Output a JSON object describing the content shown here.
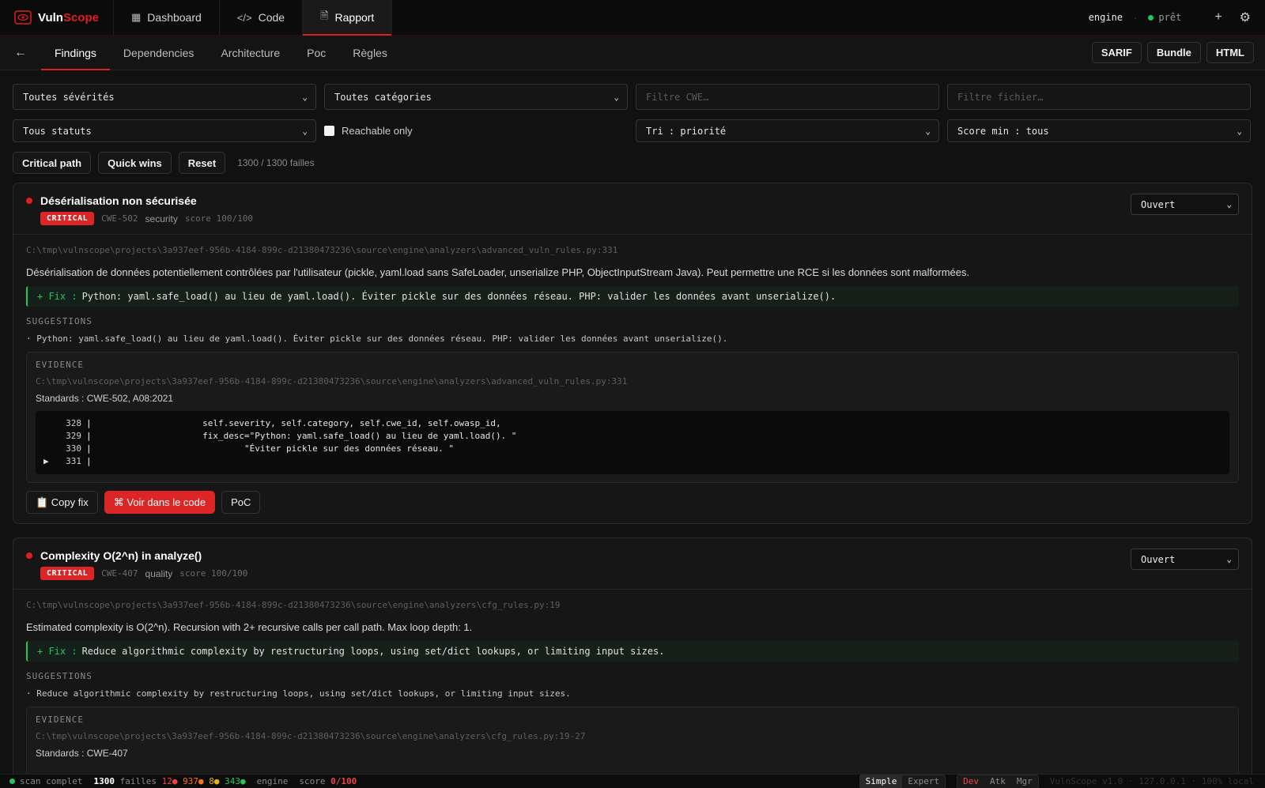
{
  "brand": {
    "name_a": "Vuln",
    "name_b": "Scope"
  },
  "topnav": [
    {
      "label": "Dashboard",
      "icon": "grid-icon"
    },
    {
      "label": "Code",
      "icon": "code-icon"
    },
    {
      "label": "Rapport",
      "icon": "document-icon",
      "active": true
    }
  ],
  "topright": {
    "engine": "engine",
    "sep": "·",
    "status": "prêt",
    "add": "+",
    "settings": "⚙"
  },
  "tabs": [
    "Findings",
    "Dependencies",
    "Architecture",
    "Poc",
    "Règles"
  ],
  "exports": [
    "SARIF",
    "Bundle",
    "HTML"
  ],
  "filters": {
    "severity": "Toutes sévérités",
    "category": "Toutes catégories",
    "cwe_placeholder": "Filtre CWE…",
    "file_placeholder": "Filtre fichier…",
    "status": "Tous statuts",
    "reachable": "Reachable only",
    "sort": "Tri : priorité",
    "score": "Score min : tous"
  },
  "quick": {
    "critical": "Critical path",
    "wins": "Quick wins",
    "reset": "Reset",
    "count": "1300 / 1300 failles"
  },
  "findings": [
    {
      "title": "Désérialisation non sécurisée",
      "severity": "CRITICAL",
      "cwe": "CWE-502",
      "category": "security",
      "score": "score 100/100",
      "status": "Ouvert",
      "path": "C:\\tmp\\vulnscope\\projects\\3a937eef-956b-4184-899c-d21380473236\\source\\engine\\analyzers\\advanced_vuln_rules.py:331",
      "description": "Désérialisation de données potentiellement contrôlées par l'utilisateur (pickle, yaml.load sans SafeLoader, unserialize PHP, ObjectInputStream Java). Peut permettre une RCE si les données sont malformées.",
      "fix_prefix": "+ Fix :",
      "fix": "Python: yaml.safe_load() au lieu de yaml.load(). Éviter pickle sur des données réseau. PHP: valider les données avant unserialize().",
      "suggestions_label": "SUGGESTIONS",
      "suggestion": "· Python: yaml.safe_load() au lieu de yaml.load(). Éviter pickle sur des données réseau. PHP: valider les données avant unserialize().",
      "evidence_label": "EVIDENCE",
      "evidence_path": "C:\\tmp\\vulnscope\\projects\\3a937eef-956b-4184-899c-d21380473236\\source\\engine\\analyzers\\advanced_vuln_rules.py:331",
      "standards": "Standards : CWE-502, A08:2021",
      "code": [
        {
          "marker": "",
          "line": "328",
          "text": "                    self.severity, self.category, self.cwe_id, self.owasp_id,"
        },
        {
          "marker": "",
          "line": "329",
          "text": "                    fix_desc=\"Python: yaml.safe_load() au lieu de yaml.load(). \""
        },
        {
          "marker": "",
          "line": "330",
          "text": "                            \"Éviter pickle sur des données réseau. \""
        },
        {
          "marker": "▶",
          "line": "331",
          "text": ""
        }
      ],
      "actions": {
        "copy": "📋 Copy fix",
        "view": "⌘ Voir dans le code",
        "poc": "PoC"
      }
    },
    {
      "title": "Complexity O(2^n) in analyze()",
      "severity": "CRITICAL",
      "cwe": "CWE-407",
      "category": "quality",
      "score": "score 100/100",
      "status": "Ouvert",
      "path": "C:\\tmp\\vulnscope\\projects\\3a937eef-956b-4184-899c-d21380473236\\source\\engine\\analyzers\\cfg_rules.py:19",
      "description": "Estimated complexity is O(2^n). Recursion with 2+ recursive calls per call path. Max loop depth: 1.",
      "fix_prefix": "+ Fix :",
      "fix": "Reduce algorithmic complexity by restructuring loops, using set/dict lookups, or limiting input sizes.",
      "suggestions_label": "SUGGESTIONS",
      "suggestion": "· Reduce algorithmic complexity by restructuring loops, using set/dict lookups, or limiting input sizes.",
      "evidence_label": "EVIDENCE",
      "evidence_path": "C:\\tmp\\vulnscope\\projects\\3a937eef-956b-4184-899c-d21380473236\\source\\engine\\analyzers\\cfg_rules.py:19-27",
      "standards": "Standards : CWE-407"
    }
  ],
  "statusbar": {
    "state": "scan complet",
    "total": "1300",
    "total_label": "failles",
    "crit": "12●",
    "high": "937●",
    "med": "8●",
    "low": "343●",
    "engine": "engine",
    "score_label": "score",
    "score": "0/100",
    "modes": [
      "Simple",
      "Expert"
    ],
    "roles": [
      "Dev",
      "Atk",
      "Mgr"
    ],
    "version": "VulnScope v1.0 · 127.0.0.1 · 100% local"
  },
  "colors": {
    "accent": "#e11d1d",
    "ok": "#22c55e",
    "bg": "#111111"
  }
}
